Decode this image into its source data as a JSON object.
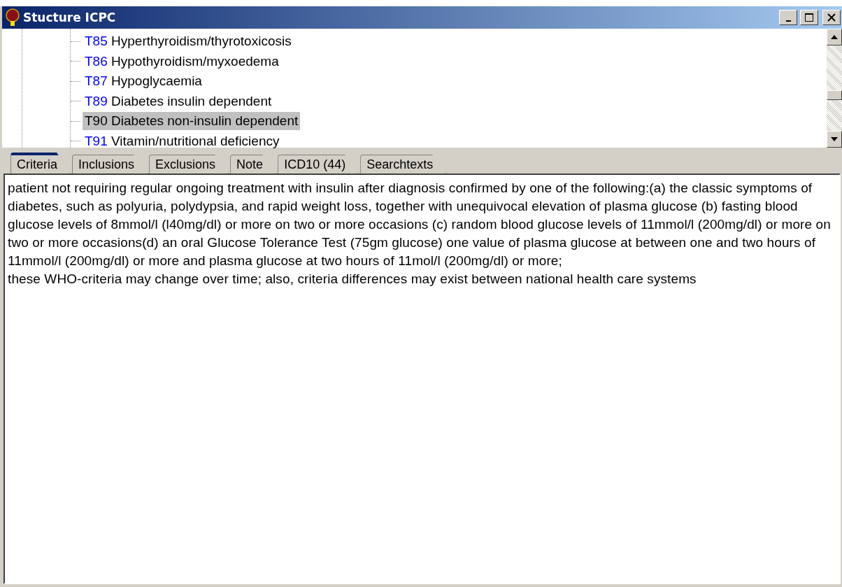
{
  "window": {
    "title": "Stucture ICPC"
  },
  "tree": {
    "items": [
      {
        "code": "T85",
        "label": "Hyperthyroidism/thyrotoxicosis",
        "selected": false
      },
      {
        "code": "T86",
        "label": "Hypothyroidism/myxoedema",
        "selected": false
      },
      {
        "code": "T87",
        "label": "Hypoglycaemia",
        "selected": false
      },
      {
        "code": "T89",
        "label": "Diabetes insulin dependent",
        "selected": false
      },
      {
        "code": "T90",
        "label": "Diabetes non-insulin dependent",
        "selected": true
      },
      {
        "code": "T91",
        "label": "Vitamin/nutritional deficiency",
        "selected": false
      }
    ]
  },
  "tabs": [
    {
      "label": "Criteria",
      "selected": true
    },
    {
      "label": "Inclusions",
      "selected": false
    },
    {
      "label": "Exclusions",
      "selected": false
    },
    {
      "label": "Note",
      "selected": false
    },
    {
      "label": "ICD10 (44)",
      "selected": false
    },
    {
      "label": "Searchtexts",
      "selected": false
    }
  ],
  "content": {
    "paragraphs": [
      "patient not requiring regular ongoing treatment with insulin after diagnosis confirmed by one of the following:(a) the classic symptoms of diabetes, such as polyuria, polydypsia, and rapid weight loss, together with unequivocal elevation of plasma glucose (b) fasting blood glucose levels of 8mmol/l (l40mg/dl) or more on two or more occasions (c) random blood glucose levels of 11mmol/l (200mg/dl) or more on two or more occasions(d) an oral Glucose Tolerance Test (75gm glucose) one value of plasma glucose at between one and two hours of 11mmol/l (200mg/dl) or more and plasma glucose at two hours of 11mol/l (200mg/dl) or more;",
      "these WHO-criteria may change over time; also, criteria differences may exist between national health care systems"
    ]
  }
}
